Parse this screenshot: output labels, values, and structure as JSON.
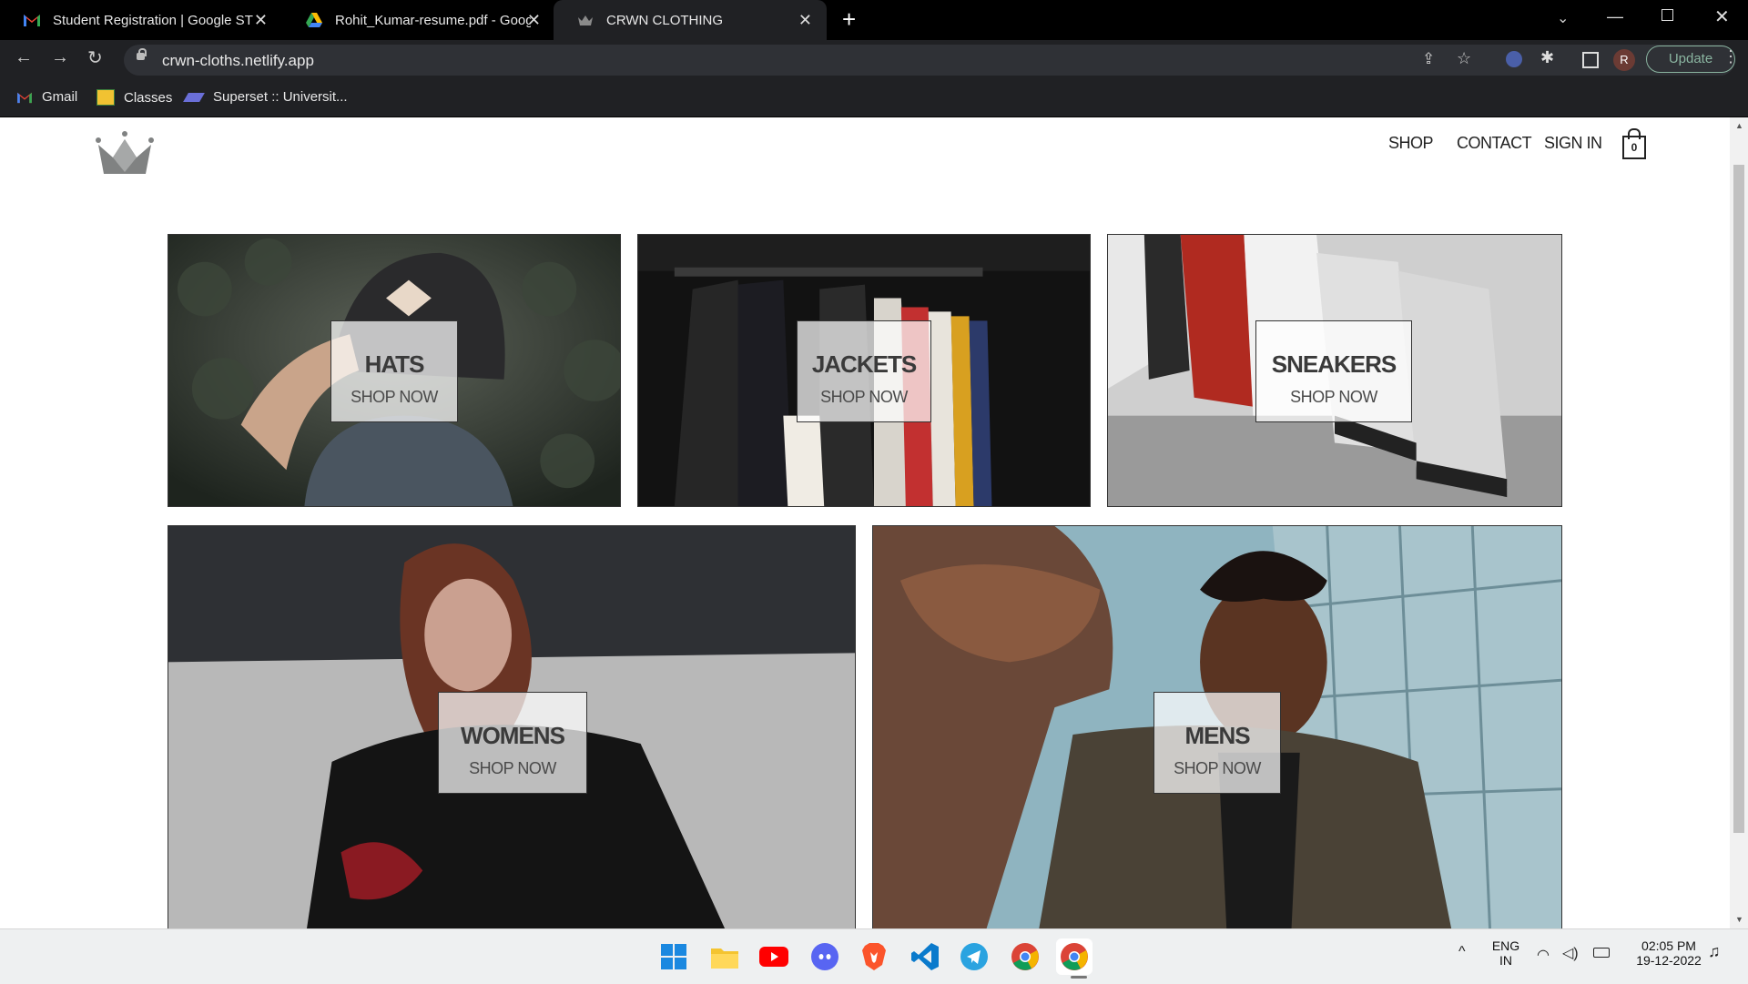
{
  "browser": {
    "tabs": [
      {
        "title": "Student Registration | Google ST"
      },
      {
        "title": "Rohit_Kumar-resume.pdf - Googl"
      },
      {
        "title": "CRWN CLOTHING"
      }
    ],
    "url": "crwn-cloths.netlify.app",
    "profile_initial": "R",
    "update_label": "Update",
    "bookmarks": [
      {
        "label": "Gmail"
      },
      {
        "label": "Classes"
      },
      {
        "label": "Superset :: Universit..."
      }
    ]
  },
  "site": {
    "nav": {
      "shop": "SHOP",
      "contact": "CONTACT",
      "sign_in": "SIGN IN",
      "cart_count": "0"
    },
    "categories": [
      {
        "title": "HATS",
        "cta": "SHOP NOW"
      },
      {
        "title": "JACKETS",
        "cta": "SHOP NOW"
      },
      {
        "title": "SNEAKERS",
        "cta": "SHOP NOW"
      },
      {
        "title": "WOMENS",
        "cta": "SHOP NOW"
      },
      {
        "title": "MENS",
        "cta": "SHOP NOW"
      }
    ]
  },
  "taskbar": {
    "lang_top": "ENG",
    "lang_bottom": "IN",
    "time": "02:05 PM",
    "date": "19-12-2022"
  },
  "colors": {
    "chrome_bg": "#202124",
    "tab_strip": "#000000",
    "update_green": "#8ab4a0"
  }
}
